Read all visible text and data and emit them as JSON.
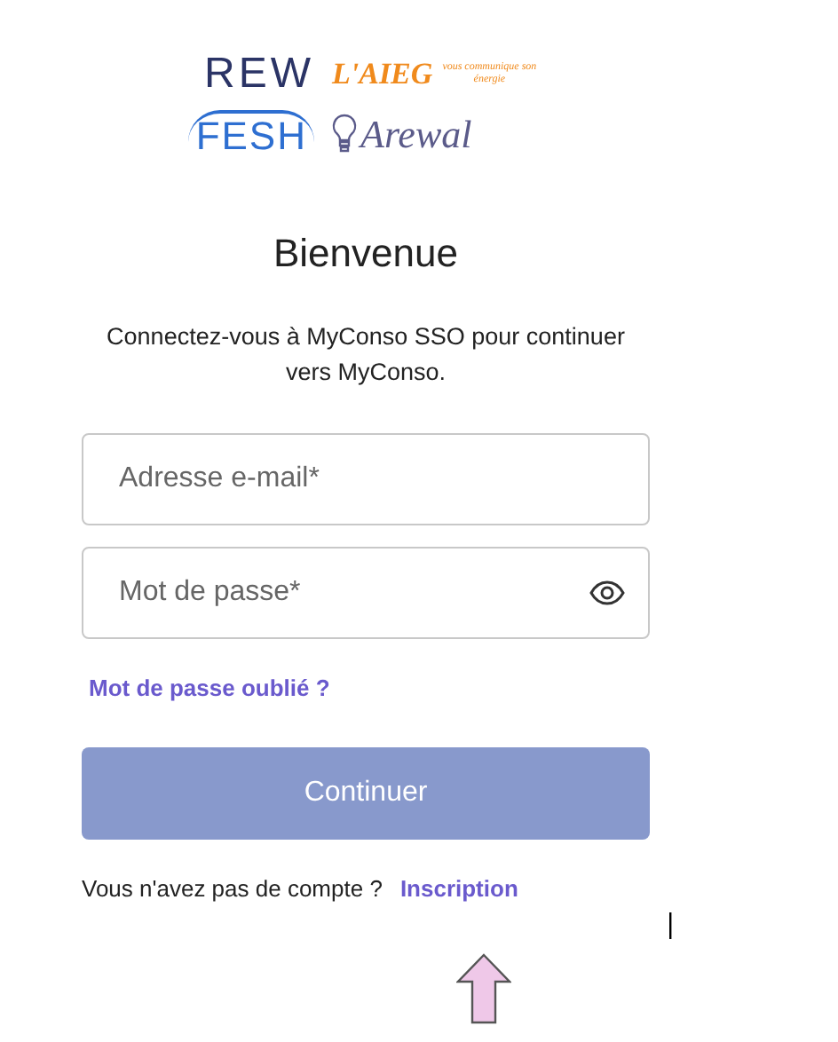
{
  "logos": [
    {
      "kind": "rew",
      "text": "REW"
    },
    {
      "kind": "aieg",
      "text": "L'AIEG",
      "tagline": "vous communique son énergie"
    },
    {
      "kind": "fesh",
      "text": "FESH"
    },
    {
      "kind": "arewal",
      "text": "Arewal"
    }
  ],
  "title": "Bienvenue",
  "intro": "Connectez-vous à MyConso SSO pour continuer vers MyConso.",
  "email_field": {
    "placeholder": "Adresse e-mail*"
  },
  "password_field": {
    "placeholder": "Mot de passe*"
  },
  "forgot_link": "Mot de passe oublié ?",
  "submit_button": {
    "label": "Continuer",
    "disabled": true
  },
  "signup": {
    "prompt": "Vous n'avez pas de compte ?",
    "link": "Inscription"
  }
}
